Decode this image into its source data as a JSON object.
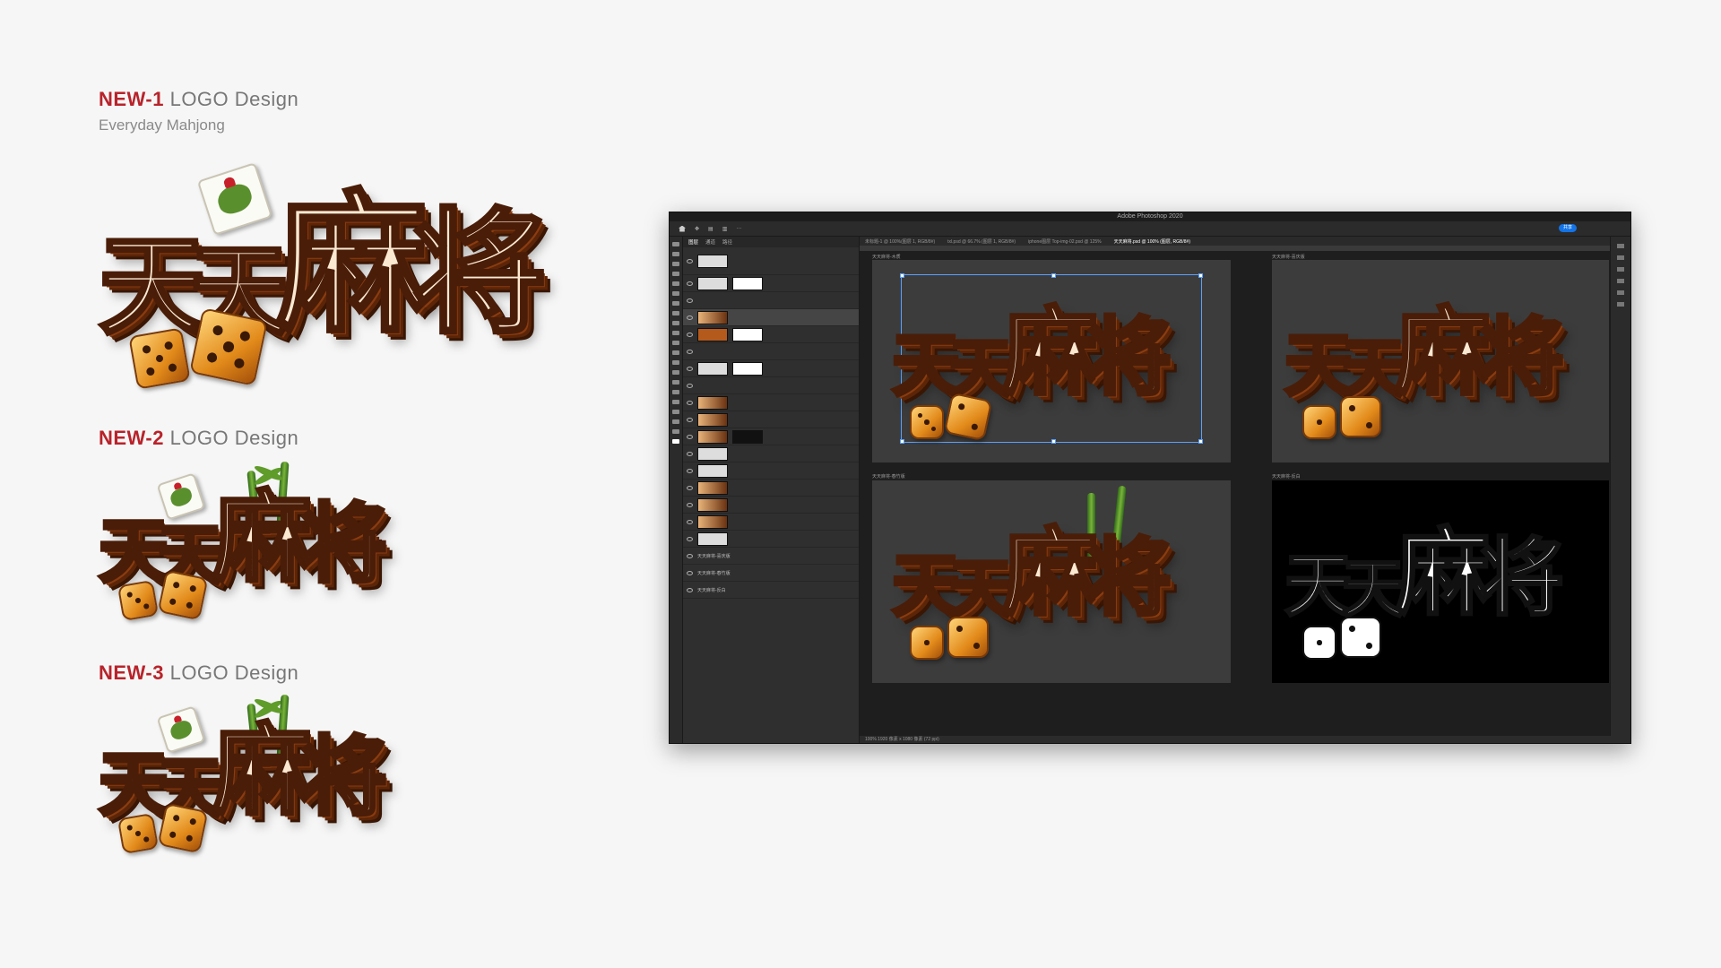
{
  "sections": [
    {
      "num": "NEW-1",
      "rest": "LOGO Design",
      "subtitle": "Everyday Mahjong"
    },
    {
      "num": "NEW-2",
      "rest": "LOGO Design"
    },
    {
      "num": "NEW-3",
      "rest": "LOGO Design"
    }
  ],
  "logo_text": [
    "天",
    "天",
    "麻",
    "将"
  ],
  "ps": {
    "title": "Adobe Photoshop 2020",
    "share_label": "共享",
    "tabs": [
      "图层",
      "通道",
      "路径"
    ],
    "doc_tabs": [
      "未标题-1 @ 100%(图层 1, RGB/8#)",
      "txl.psd @ 66.7% (图层 1, RGB/8#)",
      "iphone图层 Top-img-02.psd @ 125%",
      "天天麻将.psd @ 100% (图层, RGB/8#)"
    ],
    "artboards": [
      "天天麻将-木质",
      "天天麻将-喜庆版",
      "天天麻将-春竹版",
      "天天麻将-反白"
    ],
    "layer_groups": [
      "天天麻将-喜庆版",
      "天天麻将-春竹版",
      "天天麻将-反白"
    ],
    "status": "100%   1920 像素 x 1080 像素 (72 ppi)"
  },
  "colors": {
    "accent": "#b8232b",
    "heading_gray": "#777777",
    "ps_bg": "#252525"
  }
}
